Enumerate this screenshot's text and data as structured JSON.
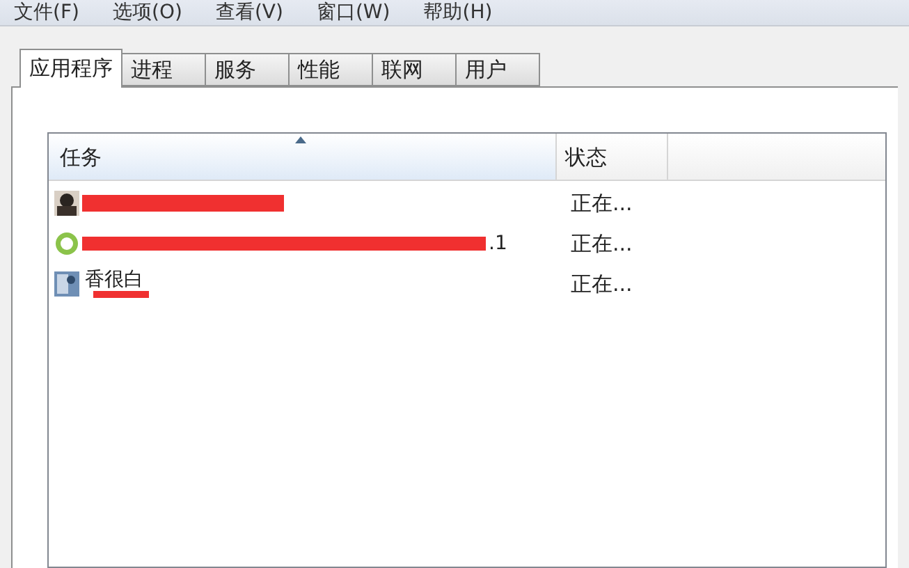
{
  "menu": [
    "文件(F)",
    "选项(O)",
    "查看(V)",
    "窗口(W)",
    "帮助(H)"
  ],
  "tabs": [
    {
      "label": "应用程序",
      "selected": true
    },
    {
      "label": "进程",
      "selected": false
    },
    {
      "label": "服务",
      "selected": false
    },
    {
      "label": "性能",
      "selected": false
    },
    {
      "label": "联网",
      "selected": false
    },
    {
      "label": "用户",
      "selected": false
    }
  ],
  "table": {
    "columns": [
      "任务",
      "状态"
    ],
    "rows": [
      {
        "kind": "avatar",
        "redacted": true,
        "status": "正在..."
      },
      {
        "kind": "globe",
        "task": ".1",
        "redacted": true,
        "status": "正在..."
      },
      {
        "kind": "photo",
        "task": "香很白",
        "redacted": true,
        "status": "正在..."
      }
    ]
  }
}
